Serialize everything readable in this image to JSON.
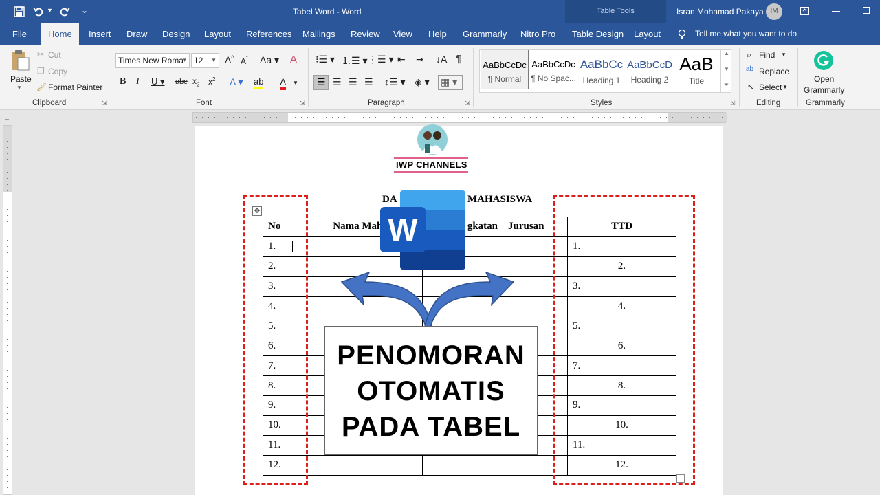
{
  "titlebar": {
    "doc_title": "Tabel Word - Word",
    "context_tools": "Table Tools",
    "user_name": "Isran Mohamad Pakaya",
    "user_initials": "IM"
  },
  "tabs": [
    "File",
    "Home",
    "Insert",
    "Draw",
    "Design",
    "Layout",
    "References",
    "Mailings",
    "Review",
    "View",
    "Help",
    "Grammarly",
    "Nitro Pro",
    "Table Design",
    "Layout"
  ],
  "tell_me": "Tell me what you want to do",
  "clipboard": {
    "paste": "Paste",
    "cut": "Cut",
    "copy": "Copy",
    "format_painter": "Format Painter",
    "group": "Clipboard"
  },
  "font": {
    "name": "Times New Roma",
    "size": "12",
    "group": "Font"
  },
  "paragraph": {
    "group": "Paragraph"
  },
  "styles": {
    "items": [
      {
        "preview": "AaBbCcDc",
        "name": "¶ Normal"
      },
      {
        "preview": "AaBbCcDc",
        "name": "¶ No Spac..."
      },
      {
        "preview": "AaBbCc",
        "name": "Heading 1"
      },
      {
        "preview": "AaBbCcD",
        "name": "Heading 2"
      },
      {
        "preview": "AaB",
        "name": "Title"
      }
    ],
    "group": "Styles"
  },
  "editing": {
    "find": "Find",
    "replace": "Replace",
    "select": "Select",
    "group": "Editing"
  },
  "grammarly": {
    "open_line1": "Open",
    "open_line2": "Grammarly",
    "group": "Grammarly"
  },
  "doc": {
    "logo_text": "IWP CHANNELS",
    "heading_left": "DA",
    "heading_right": "MAHASISWA",
    "headers": [
      "No",
      "Nama Mahasis",
      "gkatan",
      "Jurusan",
      "TTD"
    ],
    "rows": [
      [
        "1.",
        "1."
      ],
      [
        "2.",
        "2."
      ],
      [
        "3.",
        "3."
      ],
      [
        "4.",
        "4."
      ],
      [
        "5.",
        "5."
      ],
      [
        "6.",
        "6."
      ],
      [
        "7.",
        "7."
      ],
      [
        "8.",
        "8."
      ],
      [
        "9.",
        "9."
      ],
      [
        "10.",
        "10."
      ],
      [
        "11.",
        "11."
      ],
      [
        "12.",
        "12."
      ]
    ]
  },
  "overlay": {
    "word_letter": "W",
    "banner_lines": [
      "PENOMORAN",
      "OTOMATIS",
      "PADA TABEL"
    ]
  },
  "colors": {
    "word_blue": "#2b579a",
    "dash_red": "#d9201c",
    "arrow_blue": "#4472c4"
  }
}
